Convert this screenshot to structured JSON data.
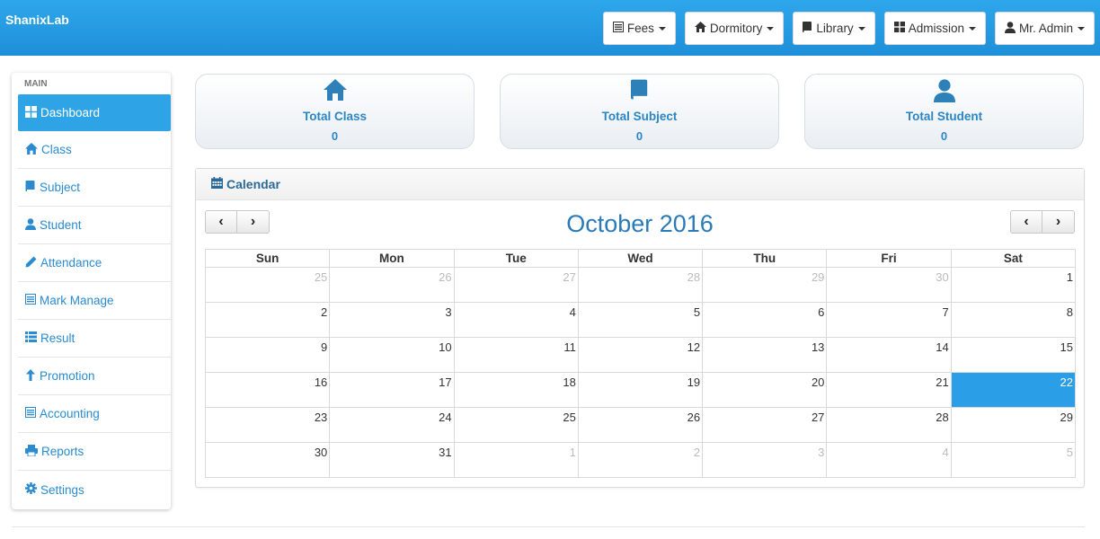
{
  "brand": "ShanixLab",
  "nav": [
    {
      "label": "Fees",
      "icon": "list-alt-icon"
    },
    {
      "label": "Dormitory",
      "icon": "home-icon"
    },
    {
      "label": "Library",
      "icon": "book-icon"
    },
    {
      "label": "Admission",
      "icon": "th-large-icon"
    },
    {
      "label": "Mr. Admin",
      "icon": "user-icon"
    }
  ],
  "sidebar": {
    "heading": "MAIN",
    "items": [
      {
        "label": "Dashboard",
        "icon": "th-large-icon",
        "active": true
      },
      {
        "label": "Class",
        "icon": "home-icon"
      },
      {
        "label": "Subject",
        "icon": "book-icon"
      },
      {
        "label": "Student",
        "icon": "user-icon"
      },
      {
        "label": "Attendance",
        "icon": "pencil-icon"
      },
      {
        "label": "Mark Manage",
        "icon": "list-alt-icon"
      },
      {
        "label": "Result",
        "icon": "th-list-icon"
      },
      {
        "label": "Promotion",
        "icon": "arrow-up-icon"
      },
      {
        "label": "Accounting",
        "icon": "list-alt-icon"
      },
      {
        "label": "Reports",
        "icon": "print-icon"
      },
      {
        "label": "Settings",
        "icon": "cog-icon"
      }
    ]
  },
  "stats": [
    {
      "label": "Total Class",
      "value": "0",
      "icon": "home-icon"
    },
    {
      "label": "Total Subject",
      "value": "0",
      "icon": "book-icon"
    },
    {
      "label": "Total Student",
      "value": "0",
      "icon": "user-icon"
    }
  ],
  "calendar": {
    "panel_title": "Calendar",
    "title": "October 2016",
    "prev": "‹",
    "next": "›",
    "weekdays": [
      "Sun",
      "Mon",
      "Tue",
      "Wed",
      "Thu",
      "Fri",
      "Sat"
    ],
    "weeks": [
      [
        {
          "d": "25",
          "o": true
        },
        {
          "d": "26",
          "o": true
        },
        {
          "d": "27",
          "o": true
        },
        {
          "d": "28",
          "o": true
        },
        {
          "d": "29",
          "o": true
        },
        {
          "d": "30",
          "o": true
        },
        {
          "d": "1"
        }
      ],
      [
        {
          "d": "2"
        },
        {
          "d": "3"
        },
        {
          "d": "4"
        },
        {
          "d": "5"
        },
        {
          "d": "6"
        },
        {
          "d": "7"
        },
        {
          "d": "8"
        }
      ],
      [
        {
          "d": "9"
        },
        {
          "d": "10"
        },
        {
          "d": "11"
        },
        {
          "d": "12"
        },
        {
          "d": "13"
        },
        {
          "d": "14"
        },
        {
          "d": "15"
        }
      ],
      [
        {
          "d": "16"
        },
        {
          "d": "17"
        },
        {
          "d": "18"
        },
        {
          "d": "19"
        },
        {
          "d": "20"
        },
        {
          "d": "21"
        },
        {
          "d": "22",
          "today": true
        }
      ],
      [
        {
          "d": "23"
        },
        {
          "d": "24"
        },
        {
          "d": "25"
        },
        {
          "d": "26"
        },
        {
          "d": "27"
        },
        {
          "d": "28"
        },
        {
          "d": "29"
        }
      ],
      [
        {
          "d": "30"
        },
        {
          "d": "31"
        },
        {
          "d": "1",
          "o": true
        },
        {
          "d": "2",
          "o": true
        },
        {
          "d": "3",
          "o": true
        },
        {
          "d": "4",
          "o": true
        },
        {
          "d": "5",
          "o": true
        }
      ]
    ]
  },
  "colors": {
    "topbar": "#2ea7ec",
    "accent": "#2ea3e6",
    "link": "#2a8bd0",
    "today": "#2a9ee6"
  }
}
